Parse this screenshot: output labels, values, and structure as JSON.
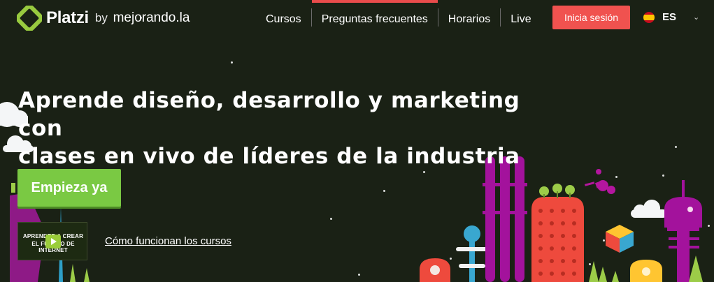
{
  "brand": {
    "name": "Platzi",
    "by": "by",
    "partner": "mejorando.la"
  },
  "nav": {
    "items": [
      {
        "label": "Cursos",
        "active": false
      },
      {
        "label": "Preguntas frecuentes",
        "active": true
      },
      {
        "label": "Horarios",
        "active": false
      },
      {
        "label": "Live",
        "active": false
      }
    ],
    "login_label": "Inicia sesión",
    "language": {
      "code": "ES",
      "flag_icon": "spain-flag-icon",
      "chevron_icon": "chevron-down-icon"
    }
  },
  "hero": {
    "headline_line1": "Aprende diseño, desarrollo y marketing con",
    "headline_line2": "clases en vivo de líderes de la industria",
    "cta_label": "Empieza ya",
    "video": {
      "title_line1": "APRENDER A CREAR",
      "title_line2": "EL FUTURO DE INTERNET",
      "play_icon": "play-icon"
    },
    "video_link_label": "Cómo funcionan los cursos"
  },
  "colors": {
    "background": "#1a2115",
    "brand_green": "#98ca3f",
    "cta_green": "#7ac943",
    "login_red": "#f0524f",
    "active_tab_red": "#e94c4c",
    "magenta": "#a3129c",
    "orange_red": "#ee4a3d",
    "teal": "#33a8c7",
    "yellow": "#ffc531"
  }
}
